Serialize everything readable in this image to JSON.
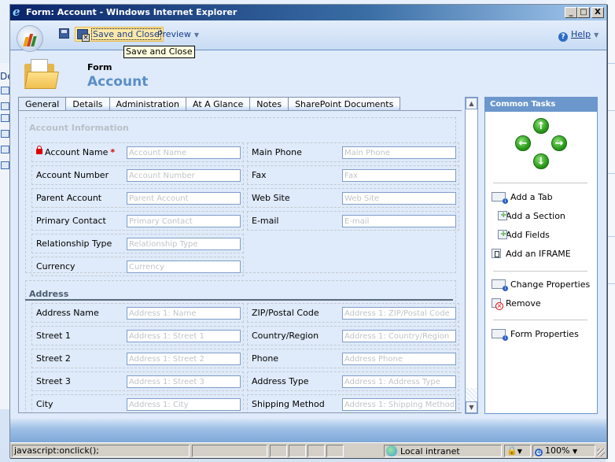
{
  "window": {
    "title": "Form: Account - Windows Internet Explorer",
    "controls": [
      "_",
      "□",
      "X"
    ]
  },
  "toolbar": {
    "save_icon": "save-icon",
    "save_close_label": "Save and Close",
    "preview_label": "Preview",
    "help_label": "Help",
    "tooltip": "Save and Close"
  },
  "header": {
    "type_label": "Form",
    "entity_name": "Account"
  },
  "tabs": [
    {
      "label": "General",
      "active": true
    },
    {
      "label": "Details"
    },
    {
      "label": "Administration"
    },
    {
      "label": "At A Glance"
    },
    {
      "label": "Notes"
    },
    {
      "label": "SharePoint Documents"
    }
  ],
  "sections": {
    "account_info": {
      "title": "Account Information",
      "fields": [
        {
          "label": "Account Name",
          "placeholder": "Account Name",
          "required": true,
          "locked": true
        },
        {
          "label": "Main Phone",
          "placeholder": "Main Phone"
        },
        {
          "label": "Account Number",
          "placeholder": "Account Number"
        },
        {
          "label": "Fax",
          "placeholder": "Fax"
        },
        {
          "label": "Parent Account",
          "placeholder": "Parent Account"
        },
        {
          "label": "Web Site",
          "placeholder": "Web Site"
        },
        {
          "label": "Primary Contact",
          "placeholder": "Primary Contact"
        },
        {
          "label": "E-mail",
          "placeholder": "E-mail"
        },
        {
          "label": "Relationship Type",
          "placeholder": "Relationship Type"
        },
        {
          "label": "Currency",
          "placeholder": "Currency"
        }
      ],
      "required_marker": "*"
    },
    "address": {
      "title": "Address",
      "fields": [
        {
          "label": "Address Name",
          "placeholder": "Address 1: Name"
        },
        {
          "label": "ZIP/Postal Code",
          "placeholder": "Address 1: ZIP/Postal Code"
        },
        {
          "label": "Street 1",
          "placeholder": "Address 1: Street 1"
        },
        {
          "label": "Country/Region",
          "placeholder": "Address 1: Country/Region"
        },
        {
          "label": "Street 2",
          "placeholder": "Address 1: Street 2"
        },
        {
          "label": "Phone",
          "placeholder": "Address Phone"
        },
        {
          "label": "Street 3",
          "placeholder": "Address 1: Street 3"
        },
        {
          "label": "Address Type",
          "placeholder": "Address 1: Address Type"
        },
        {
          "label": "City",
          "placeholder": "Address 1: City"
        },
        {
          "label": "Shipping Method",
          "placeholder": "Address 1: Shipping Method"
        }
      ]
    }
  },
  "common_tasks": {
    "title": "Common Tasks",
    "arrows": [
      "↑",
      "←",
      "→",
      "↓"
    ],
    "items": [
      {
        "label": "Add a Tab",
        "icon": "add-tab-icon"
      },
      {
        "label": "Add a Section",
        "icon": "add-section-icon"
      },
      {
        "label": "Add Fields",
        "icon": "add-fields-icon"
      },
      {
        "label": "Add an IFRAME",
        "icon": "add-iframe-icon"
      },
      {
        "label": "Change Properties",
        "icon": "change-properties-icon"
      },
      {
        "label": "Remove",
        "icon": "remove-icon"
      },
      {
        "label": "Form Properties",
        "icon": "form-properties-icon"
      }
    ]
  },
  "statusbar": {
    "text": "javascript:onclick();",
    "zone": "Local intranet",
    "zoom": "100%"
  },
  "background": {
    "left_partial_text": "De"
  },
  "scrollbar": {
    "up": "▲",
    "down": "▼"
  }
}
